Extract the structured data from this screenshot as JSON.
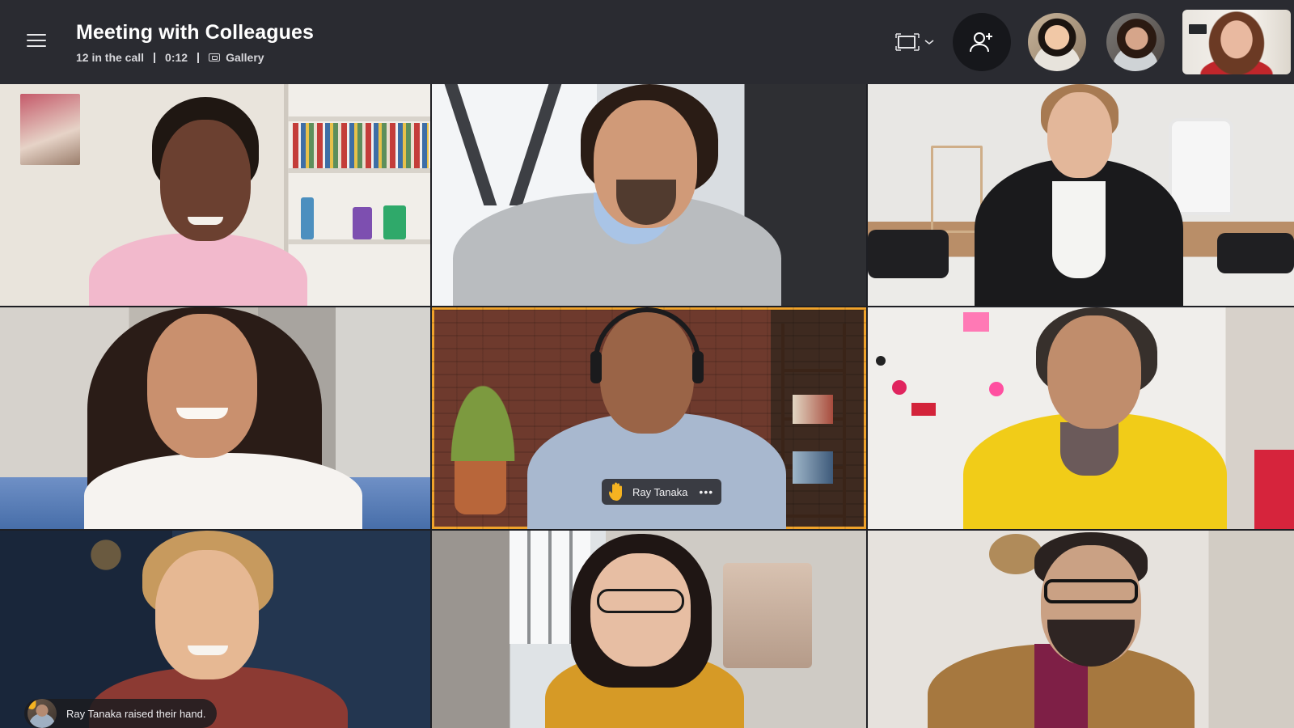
{
  "meeting": {
    "title": "Meeting with Colleagues",
    "participants_count": "12 in the call",
    "duration": "0:12",
    "view_mode": "Gallery"
  },
  "icons": {
    "menu": "hamburger-menu-icon",
    "view": "frame-view-icon",
    "chevron": "chevron-down-icon",
    "add": "add-person-icon",
    "gallery": "gallery-icon",
    "hand": "raised-hand-icon",
    "more": "more-options-icon"
  },
  "highlight_color": "#f0a32b",
  "active_speaker": {
    "name": "Ray Tanaka",
    "hand_raised": true
  },
  "notification": {
    "text": "Ray Tanaka raised their hand."
  },
  "tiles_count": 9
}
